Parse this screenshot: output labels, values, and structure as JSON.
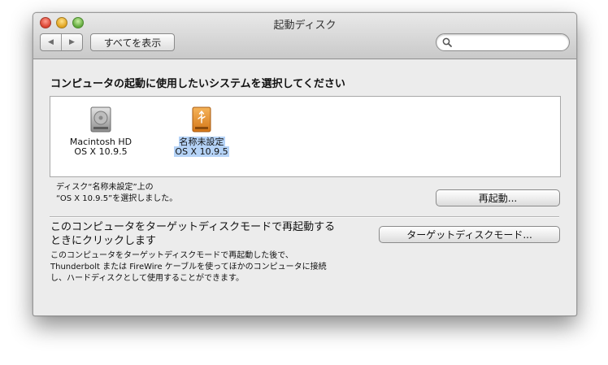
{
  "window": {
    "title": "起動ディスク"
  },
  "toolbar": {
    "back_glyph": "◀",
    "forward_glyph": "▶",
    "show_all_label": "すべてを表示",
    "search_placeholder": "",
    "search_icon": "magnifier-icon"
  },
  "main": {
    "heading": "コンピュータの起動に使用したいシステムを選択してください",
    "disks": [
      {
        "name": "Macintosh HD",
        "os": "OS X 10.9.5",
        "icon": "internal-hard-disk-icon",
        "selected": false
      },
      {
        "name": "名称未設定",
        "os": "OS X 10.9.5",
        "icon": "usb-disk-icon",
        "selected": true
      }
    ],
    "status_line1": "ディスク“名称未設定”上の",
    "status_line2": "“OS X 10.9.5”を選択しました。",
    "restart_label": "再起動...",
    "target_mode": {
      "title_line1": "このコンピュータをターゲットディスクモードで再起動する",
      "title_line2": "ときにクリックします",
      "desc_line1": "このコンピュータをターゲットディスクモードで再起動した後で、",
      "desc_line2": "Thunderbolt または FireWire ケーブルを使ってほかのコンピュータに接続",
      "desc_line3": "し、ハードディスクとして使用することができます。",
      "button_label": "ターゲットディスクモード..."
    }
  },
  "colors": {
    "selection": "#b5d3f7",
    "usb_disk": "#e8922a"
  }
}
